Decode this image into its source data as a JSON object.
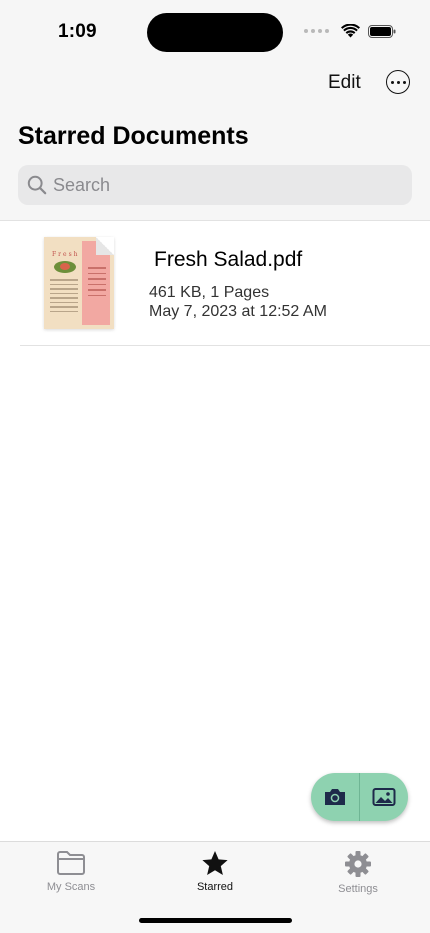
{
  "status_bar": {
    "time": "1:09"
  },
  "nav": {
    "edit_label": "Edit",
    "more_icon": "ellipsis-circle-icon"
  },
  "page": {
    "title": "Starred Documents"
  },
  "search": {
    "placeholder": "Search",
    "icon": "search-icon"
  },
  "documents": [
    {
      "name": "Fresh Salad.pdf",
      "size_pages": "461 KB, 1 Pages",
      "date": "May 7, 2023 at 12:52 AM",
      "thumb_title": "Fresh"
    }
  ],
  "fab": {
    "camera_icon": "camera-icon",
    "photo_icon": "photo-icon",
    "color": "#8ed2b0"
  },
  "tab_bar": {
    "tabs": [
      {
        "label": "My Scans",
        "icon": "folder-icon",
        "active": false
      },
      {
        "label": "Starred",
        "icon": "star-icon",
        "active": true
      },
      {
        "label": "Settings",
        "icon": "gear-icon",
        "active": false
      }
    ]
  }
}
